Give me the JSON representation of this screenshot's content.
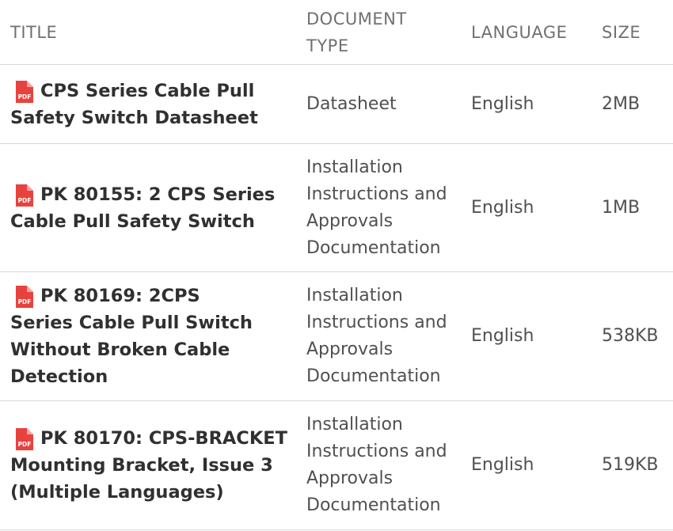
{
  "table": {
    "headers": {
      "title": "TITLE",
      "document_type": "DOCUMENT TYPE",
      "language": "LANGUAGE",
      "size": "SIZE"
    },
    "rows": [
      {
        "title": "CPS Series Cable Pull Safety Switch Datasheet",
        "document_type": "Datasheet",
        "language": "English",
        "size": "2MB"
      },
      {
        "title": "PK 80155: 2 CPS Series Cable Pull Safety Switch",
        "document_type": "Installation Instructions and Approvals Documentation",
        "language": "English",
        "size": "1MB"
      },
      {
        "title": "PK 80169: 2CPS Series Cable Pull Switch Without Broken Cable Detection",
        "document_type": "Installation Instructions and Approvals Documentation",
        "language": "English",
        "size": "538KB"
      },
      {
        "title": "PK 80170: CPS-BRACKET Mounting Bracket, Issue 3 (Multiple Languages)",
        "document_type": "Installation Instructions and Approvals Documentation",
        "language": "English",
        "size": "519KB"
      }
    ]
  },
  "icons": {
    "pdf_icon": "pdf-file-icon",
    "pdf_icon_label": "PDF",
    "pdf_icon_color": "#e8423f"
  }
}
